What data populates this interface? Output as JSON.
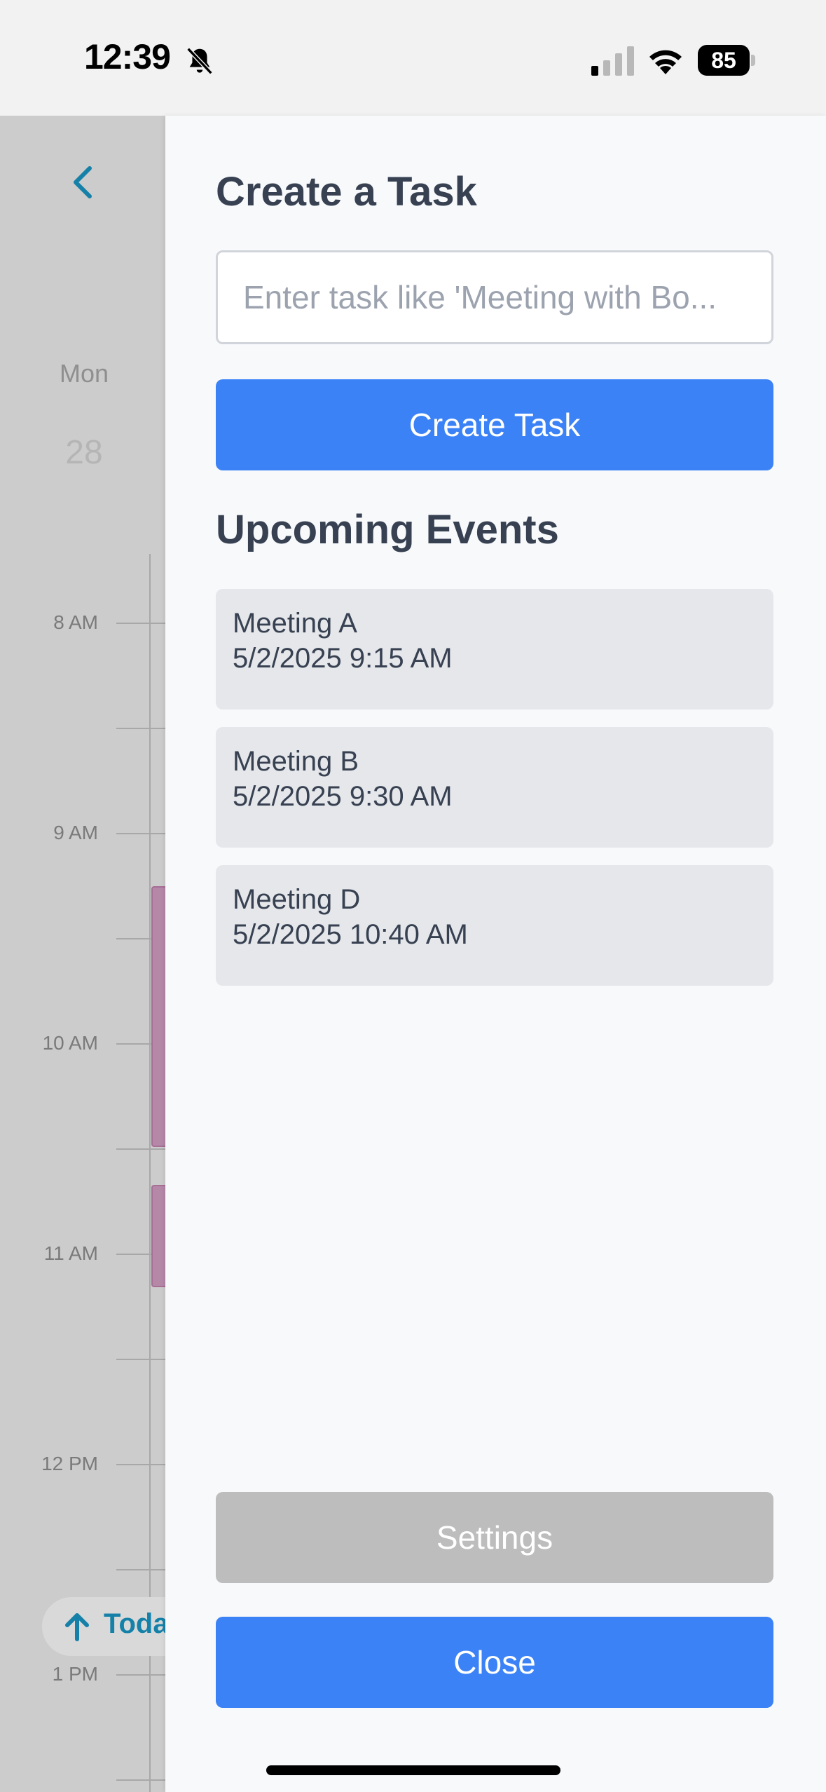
{
  "status_bar": {
    "time": "12:39",
    "battery": "85"
  },
  "calendar": {
    "day_name": "Mon",
    "day_number": "28",
    "hours": [
      "8 AM",
      "9 AM",
      "10 AM",
      "11 AM",
      "12 PM",
      "1 PM"
    ],
    "today_label": "Toda",
    "event_color": "#b588a8"
  },
  "drawer": {
    "title": "Create a Task",
    "task_input": {
      "placeholder": "Enter task like 'Meeting with Bo...",
      "value": ""
    },
    "create_label": "Create Task",
    "upcoming_title": "Upcoming Events",
    "events": [
      {
        "name": "Meeting A",
        "time": "5/2/2025 9:15 AM"
      },
      {
        "name": "Meeting B",
        "time": "5/2/2025 9:30 AM"
      },
      {
        "name": "Meeting D",
        "time": "5/2/2025 10:40 AM"
      }
    ],
    "settings_label": "Settings",
    "close_label": "Close"
  },
  "colors": {
    "primary": "#3b82f6",
    "secondary_button": "#bdbdbd",
    "card": "#e5e7eb",
    "text": "#374151",
    "accent": "#1681a8"
  }
}
